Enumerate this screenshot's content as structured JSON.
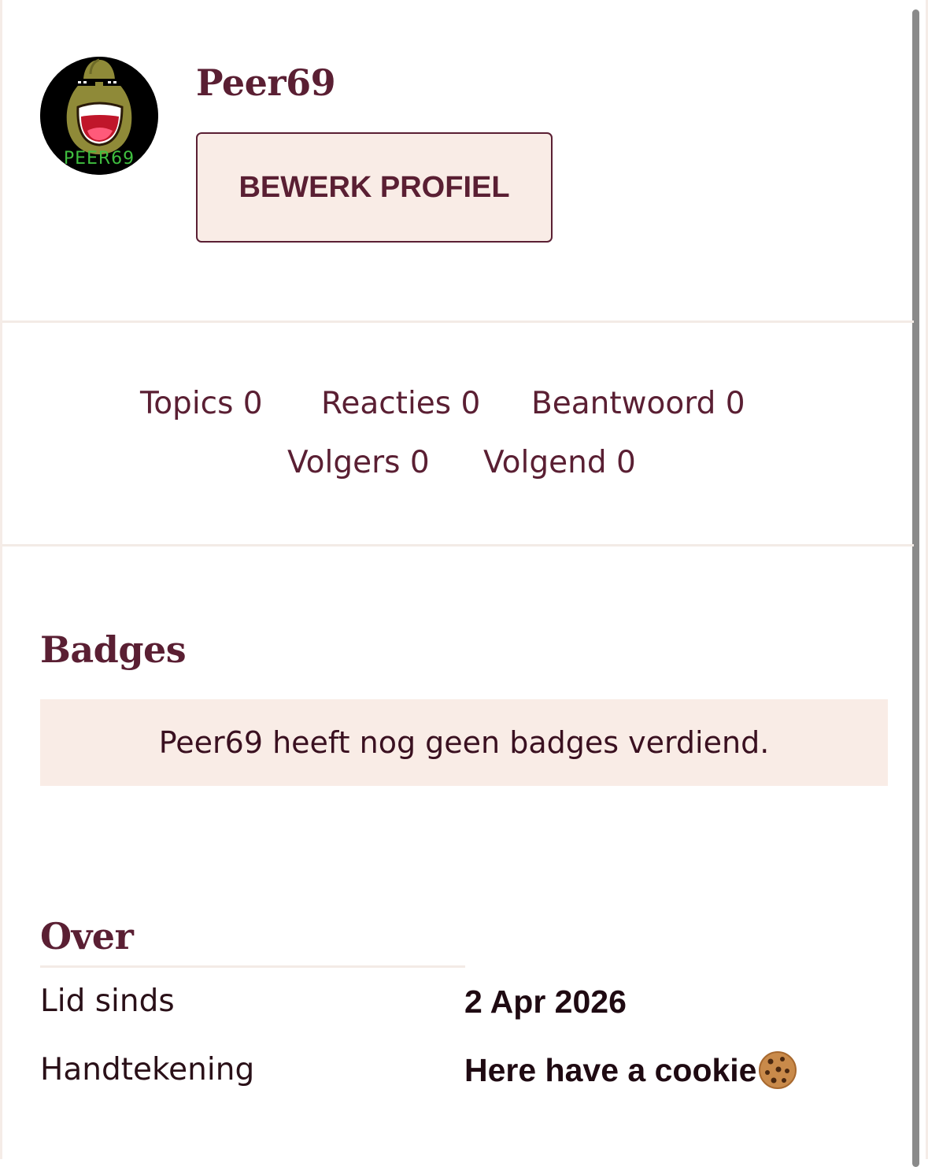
{
  "profile": {
    "username": "Peer69",
    "avatar_text": "PEER69",
    "edit_button_label": "BEWERK PROFIEL"
  },
  "stats": {
    "topics": "Topics 0",
    "reacties": "Reacties 0",
    "beantwoord": "Beantwoord 0",
    "volgers": "Volgers 0",
    "volgend": "Volgend 0"
  },
  "badges": {
    "title": "Badges",
    "empty_message": "Peer69 heeft nog geen badges verdiend."
  },
  "over": {
    "title": "Over",
    "rows": [
      {
        "label": "Lid sinds",
        "value": "2 Apr 2026"
      },
      {
        "label": "Handtekening",
        "value": "Here have a cookie",
        "icon": "cookie-icon"
      }
    ]
  },
  "colors": {
    "brand": "#5a1f33",
    "panel": "#f9ece6",
    "divider": "#f3ebe6"
  }
}
